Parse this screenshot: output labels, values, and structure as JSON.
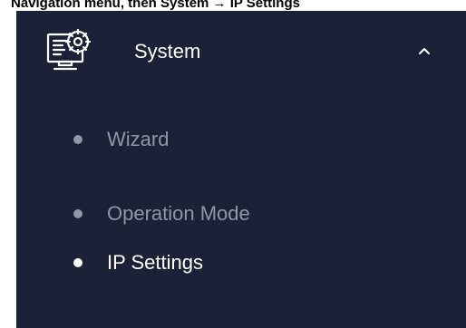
{
  "caption": {
    "text": "Navigation menu, then System → IP Settings"
  },
  "menu": {
    "header": {
      "icon": "system-settings-monitor-icon",
      "label": "System",
      "chevron": "chevron-up-icon"
    },
    "items": [
      {
        "label": "Wizard",
        "active": false
      },
      {
        "label": "Operation Mode",
        "active": false
      },
      {
        "label": "IP Settings",
        "active": true
      }
    ]
  },
  "colors": {
    "menu_background": "#1b2136",
    "active_text": "#ffffff",
    "inactive_text": "#8f96a8"
  }
}
